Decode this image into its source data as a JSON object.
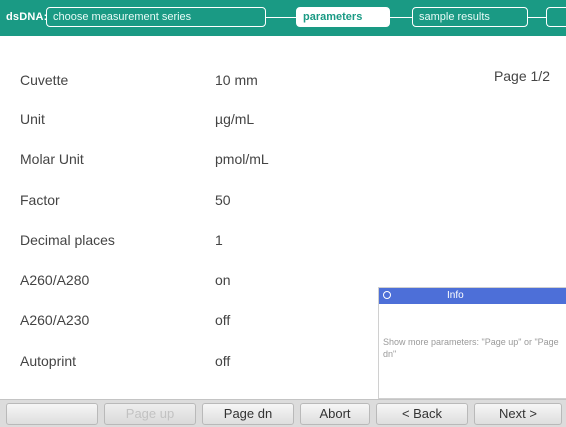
{
  "topbar": {
    "title": "dsDNA:",
    "steps": [
      {
        "label": "choose measurement series",
        "active": false
      },
      {
        "label": "parameters",
        "active": true
      },
      {
        "label": "sample results",
        "active": false
      }
    ]
  },
  "page_indicator": "Page 1/2",
  "parameters": [
    {
      "label": "Cuvette",
      "value": "10 mm"
    },
    {
      "label": "Unit",
      "value": "µg/mL"
    },
    {
      "label": "Molar Unit",
      "value": "pmol/mL"
    },
    {
      "label": "Factor",
      "value": "50"
    },
    {
      "label": "Decimal places",
      "value": "1"
    },
    {
      "label": "A260/A280",
      "value": "on"
    },
    {
      "label": "A260/A230",
      "value": "off"
    },
    {
      "label": "Autoprint",
      "value": "off"
    }
  ],
  "info_panel": {
    "title": "Info",
    "text": "Show more parameters: \"Page up\" or \"Page dn\""
  },
  "bottom_buttons": {
    "page_up": "Page up",
    "page_dn": "Page dn",
    "abort": "Abort",
    "back": "< Back",
    "next": "Next >"
  }
}
